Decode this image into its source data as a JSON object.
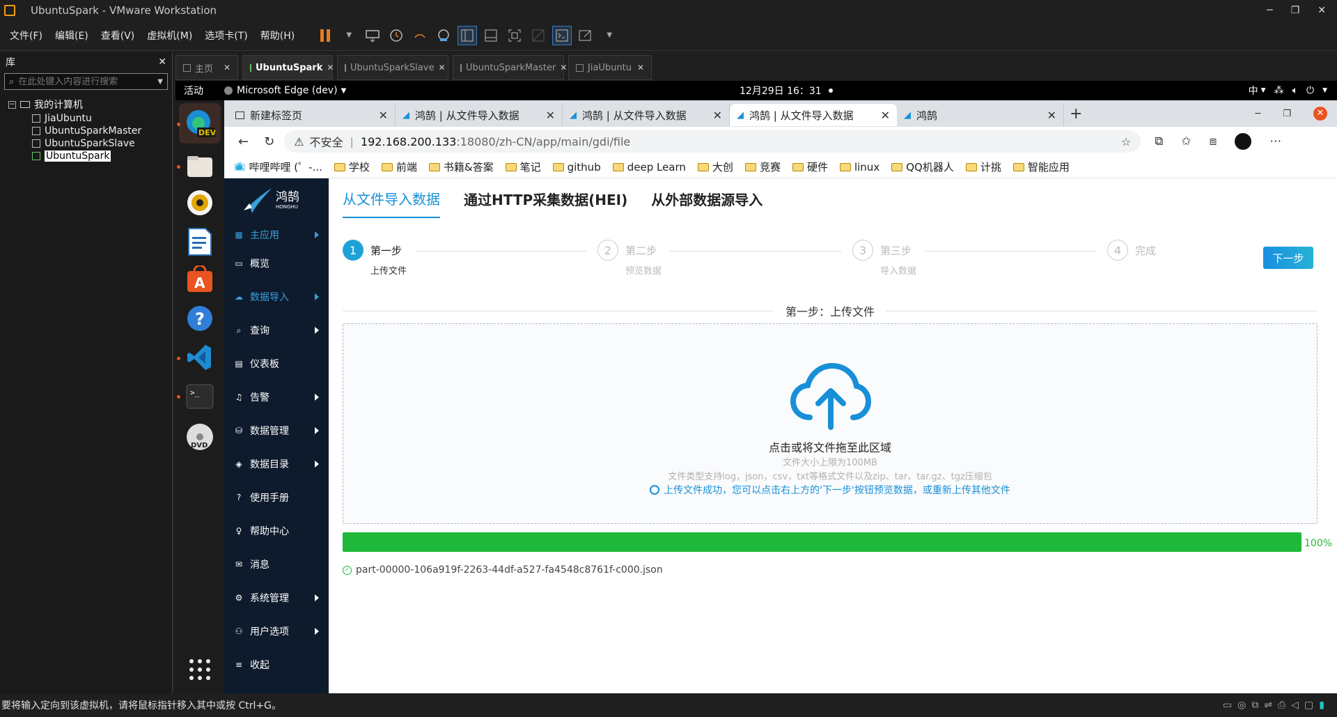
{
  "window": {
    "title": "UbuntuSpark - VMware Workstation"
  },
  "vm_menu": [
    "文件(F)",
    "编辑(E)",
    "查看(V)",
    "虚拟机(M)",
    "选项卡(T)",
    "帮助(H)"
  ],
  "library": {
    "title": "库",
    "search_placeholder": "在此处键入内容进行搜索",
    "root": "我的计算机",
    "items": [
      "JiaUbuntu",
      "UbuntuSparkMaster",
      "UbuntuSparkSlave",
      "UbuntuSpark"
    ]
  },
  "vm_tabs": [
    "主页",
    "UbuntuSpark",
    "UbuntuSparkSlave",
    "UbuntuSparkMaster",
    "JiaUbuntu"
  ],
  "ubuntu_top": {
    "activities": "活动",
    "app": "Microsoft Edge (dev)",
    "clock": "12月29日  16：31",
    "ime": "中"
  },
  "edge_tabs": [
    "新建标签页",
    "鸿鹄 | 从文件导入数据",
    "鸿鹄 | 从文件导入数据",
    "鸿鹄 | 从文件导入数据",
    "鸿鹄"
  ],
  "address": {
    "insecure": "不安全",
    "host": "192.168.200.133",
    "rest": ":18080/zh-CN/app/main/gdi/file"
  },
  "bookmarks": [
    "哔哩哔哩 (゜-...",
    "学校",
    "前端",
    "书籍&答案",
    "笔记",
    "github",
    "deep Learn",
    "大创",
    "竞赛",
    "硬件",
    "linux",
    "QQ机器人",
    "计挑",
    "智能应用"
  ],
  "logo": {
    "name": "鸿鹄",
    "sub": "HONGHU"
  },
  "sidebar": [
    "主应用",
    "概览",
    "数据导入",
    "查询",
    "仪表板",
    "告警",
    "数据管理",
    "数据目录",
    "使用手册",
    "帮助中心",
    "消息",
    "系统管理",
    "用户选项",
    "收起"
  ],
  "page_tabs": [
    "从文件导入数据",
    "通过HTTP采集数据(HEI)",
    "从外部数据源导入"
  ],
  "steps": [
    {
      "n": "1",
      "title": "第一步",
      "sub": "上传文件"
    },
    {
      "n": "2",
      "title": "第二步",
      "sub": "预览数据"
    },
    {
      "n": "3",
      "title": "第三步",
      "sub": "导入数据"
    },
    {
      "n": "4",
      "title": "完成",
      "sub": ""
    }
  ],
  "next_button": "下一步",
  "divider": "第一步：上传文件",
  "upload": {
    "main": "点击或将文件拖至此区域",
    "limit": "文件大小上限为100MB",
    "types": "文件类型支持log，json，csv，txt等格式文件以及zip、tar、tar.gz、tgz压缩包",
    "success": "上传文件成功，您可以点击右上方的'下一步'按钮预览数据，或重新上传其他文件"
  },
  "progress": {
    "value": 100,
    "label": "100%"
  },
  "file_name": "part-00000-106a919f-2263-44df-a527-fa4548c8761f-c000.json",
  "status_bar": "要将输入定向到该虚拟机，请将鼠标指针移入其中或按 Ctrl+G。",
  "colors": {
    "accent": "#1890d8",
    "progress": "#20b83a",
    "sidebar": "#0e1b2d"
  }
}
